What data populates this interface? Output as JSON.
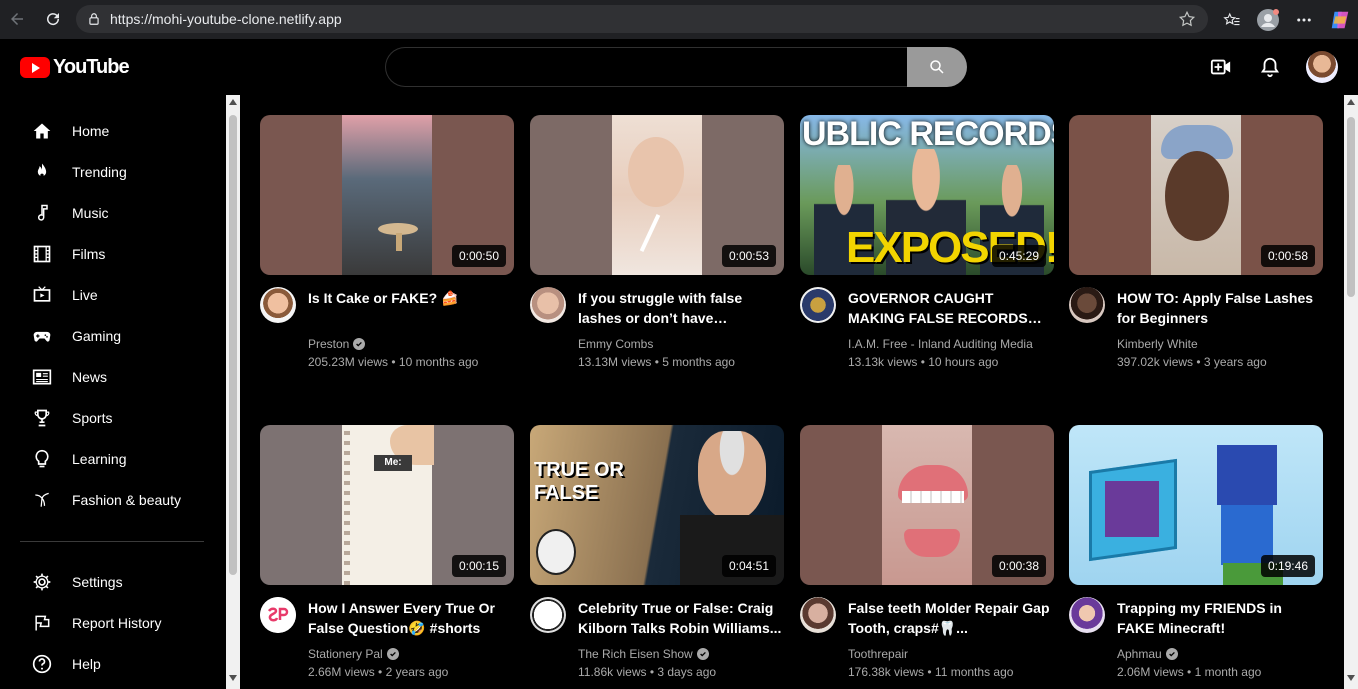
{
  "browser": {
    "url": "https://mohi-youtube-clone.netlify.app"
  },
  "header": {
    "logo_text": "YouTube",
    "search_placeholder": "",
    "search_value": ""
  },
  "sidebar": {
    "items": [
      {
        "label": "Home",
        "icon": "home-icon"
      },
      {
        "label": "Trending",
        "icon": "flame-icon"
      },
      {
        "label": "Music",
        "icon": "music-note-icon"
      },
      {
        "label": "Films",
        "icon": "film-icon"
      },
      {
        "label": "Live",
        "icon": "live-tv-icon"
      },
      {
        "label": "Gaming",
        "icon": "gamepad-icon"
      },
      {
        "label": "News",
        "icon": "newspaper-icon"
      },
      {
        "label": "Sports",
        "icon": "trophy-icon"
      },
      {
        "label": "Learning",
        "icon": "lightbulb-icon"
      },
      {
        "label": "Fashion & beauty",
        "icon": "hanger-icon"
      }
    ],
    "bottom_items": [
      {
        "label": "Settings",
        "icon": "gear-icon"
      },
      {
        "label": "Report History",
        "icon": "flag-icon"
      },
      {
        "label": "Help",
        "icon": "help-icon"
      }
    ]
  },
  "videos": [
    {
      "title": "Is It Cake or FAKE? 🍰",
      "channel": "Preston",
      "verified": true,
      "views": "205.23M views",
      "age": "10 months ago",
      "duration": "0:00:50",
      "thumb_color": "#7a5750"
    },
    {
      "title": "If you struggle with false lashes or don’t have eyelashe...",
      "channel": "Emmy Combs",
      "verified": false,
      "views": "13.13M views",
      "age": "5 months ago",
      "duration": "0:00:53",
      "thumb_color": "#7d6a66"
    },
    {
      "title": "GOVERNOR CAUGHT MAKING FALSE RECORDS JUST FOR...",
      "channel": "I.A.M. Free - Inland Auditing Media",
      "verified": false,
      "views": "13.13k views",
      "age": "10 hours ago",
      "duration": "0:45:29",
      "thumb_color": "#3a5a2a"
    },
    {
      "title": "HOW TO: Apply False Lashes for Beginners",
      "channel": "Kimberly White",
      "verified": false,
      "views": "397.02k views",
      "age": "3 years ago",
      "duration": "0:00:58",
      "thumb_color": "#7a5248"
    },
    {
      "title": "How I Answer Every True Or False Question🤣 #shorts",
      "channel": "Stationery Pal",
      "verified": true,
      "views": "2.66M views",
      "age": "2 years ago",
      "duration": "0:00:15",
      "thumb_color": "#7d7272"
    },
    {
      "title": "Celebrity True or False: Craig Kilborn Talks Robin Williams...",
      "channel": "The Rich Eisen Show",
      "verified": true,
      "views": "11.86k views",
      "age": "3 days ago",
      "duration": "0:04:51",
      "thumb_color": "#2a2a3a"
    },
    {
      "title": "False teeth Molder Repair Gap Tooth, craps#🦷...",
      "channel": "Toothrepair",
      "verified": false,
      "views": "176.38k views",
      "age": "11 months ago",
      "duration": "0:00:38",
      "thumb_color": "#7a5750"
    },
    {
      "title": "Trapping my FRIENDS in FAKE Minecraft!",
      "channel": "Aphmau",
      "verified": true,
      "views": "2.06M views",
      "age": "1 month ago",
      "duration": "0:19:46",
      "thumb_color": "#9fd4f0"
    }
  ]
}
